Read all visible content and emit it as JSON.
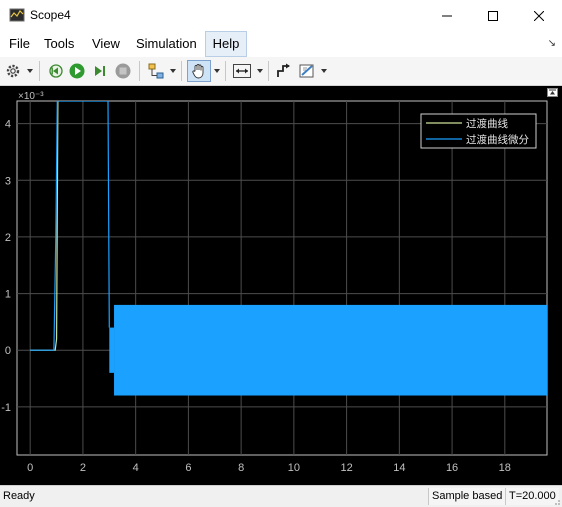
{
  "window": {
    "title": "Scope4",
    "icon": "scope-app-icon",
    "controls": [
      "minimize-icon",
      "maximize-icon",
      "close-icon"
    ]
  },
  "menu": {
    "items": [
      {
        "label": "File"
      },
      {
        "label": "Tools"
      },
      {
        "label": "View"
      },
      {
        "label": "Simulation"
      },
      {
        "label": "Help"
      }
    ],
    "active": "Help",
    "undock_icon": "undock-arrow-icon"
  },
  "toolbar": {
    "icons": [
      "settings-gear-icon",
      "step-back-icon",
      "run-icon",
      "step-forward-icon",
      "stop-icon",
      "highlight-block-icon",
      "pan-hand-icon",
      "zoom-axes-icon",
      "drawing-style-icon",
      "data-cursor-icon"
    ],
    "pressed": "pan-hand-icon"
  },
  "plot": {
    "exponent_label": "×10⁻³",
    "background": "#000000",
    "axis_color": "#c0c0c0",
    "grid_color": "#4d4d4d",
    "series_colors": {
      "line1": "#cde19b",
      "line2": "#1ba1ff"
    }
  },
  "chart_data": {
    "type": "line",
    "title": "",
    "xlabel": "",
    "ylabel": "",
    "xlim": [
      -0.5,
      19.6
    ],
    "ylim": [
      -1.85,
      4.4
    ],
    "y_scale_note": "×10⁻³",
    "x_ticks": [
      0,
      2,
      4,
      6,
      8,
      10,
      12,
      14,
      16,
      18
    ],
    "x_tick_labels": [
      "0",
      "2",
      "4",
      "6",
      "8",
      "10",
      "12",
      "14",
      "16",
      "18"
    ],
    "y_ticks": [
      -1,
      0,
      1,
      2,
      3,
      4
    ],
    "y_tick_labels": [
      "-1",
      "0",
      "1",
      "2",
      "3",
      "4"
    ],
    "grid": true,
    "legend_position": "top-right",
    "series": [
      {
        "name": "过渡曲线",
        "color": "#cde19b",
        "points": [
          [
            0,
            0
          ],
          [
            0.95,
            0
          ],
          [
            1.0,
            0.2
          ],
          [
            1.05,
            4.4
          ],
          [
            1.1,
            4.4
          ]
        ]
      },
      {
        "name": "过渡曲线微分",
        "color": "#1ba1ff",
        "points": [
          [
            0,
            0
          ],
          [
            0.9,
            0
          ],
          [
            0.97,
            2.0
          ],
          [
            1.03,
            4.4
          ],
          [
            2.95,
            4.4
          ],
          [
            3.0,
            0.4
          ]
        ],
        "band": [
          {
            "x0": 3.0,
            "x1": 3.18,
            "ymin": -0.4,
            "ymax": 0.4
          },
          {
            "x0": 3.18,
            "x1": 19.6,
            "ymin": -0.8,
            "ymax": 0.8
          }
        ]
      }
    ]
  },
  "status": {
    "text": "Ready",
    "mode": "Sample based",
    "time": "T=20.000"
  }
}
